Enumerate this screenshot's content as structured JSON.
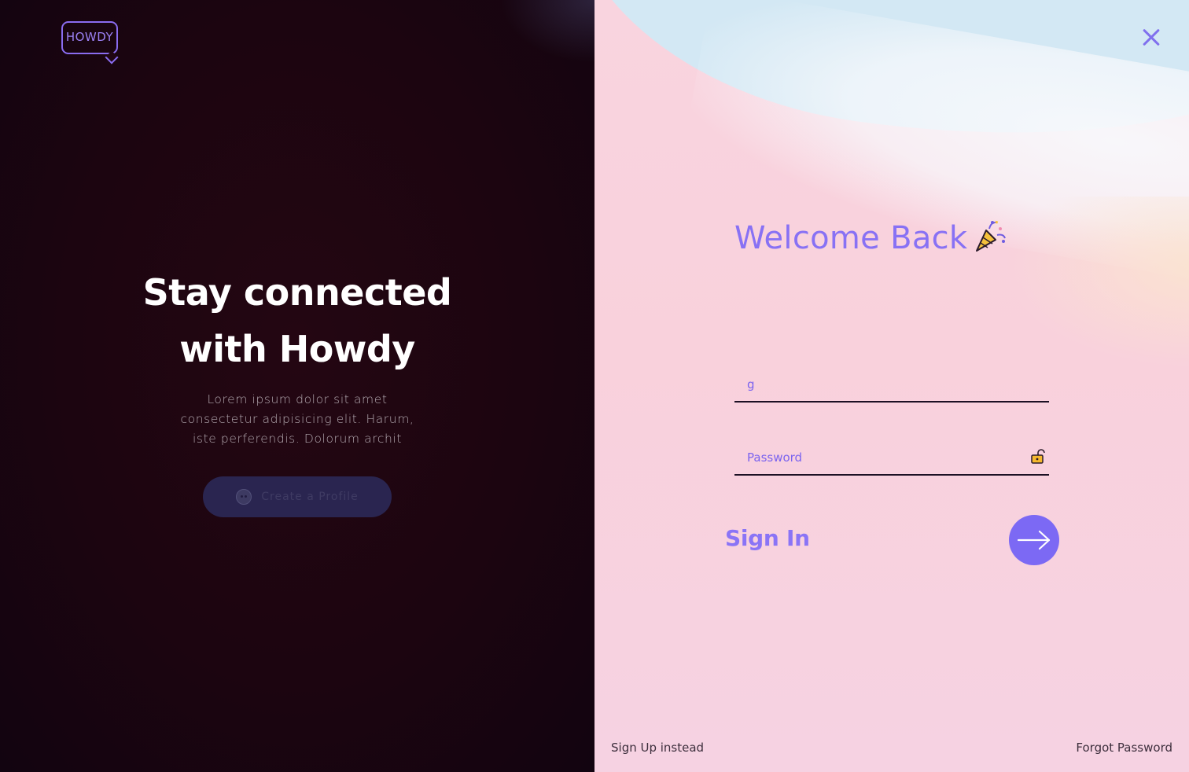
{
  "brand": {
    "logo_text": "HOWDY",
    "accent_color": "#8a6cf0"
  },
  "left_panel": {
    "title_line1": "Stay connected",
    "title_line2": "with Howdy",
    "description_line1": "Lorem ipsum dolor sit amet",
    "description_line2": "consectetur adipisicing elit. Harum,",
    "description_line3": "iste perferendis. Dolorum archit",
    "create_button_label": "Create a Profile",
    "create_button_icon": "face-icon"
  },
  "right_panel": {
    "close_icon": "close-icon",
    "welcome_text": "Welcome Back",
    "welcome_icon": "party-popper-icon",
    "username_value": "g",
    "password_placeholder": "Password",
    "password_icon": "lock-icon",
    "signin_label": "Sign In",
    "signin_icon": "arrow-right-icon",
    "signup_link": "Sign Up instead",
    "forgot_link": "Forgot Password",
    "accent_color": "#7c69f4"
  }
}
